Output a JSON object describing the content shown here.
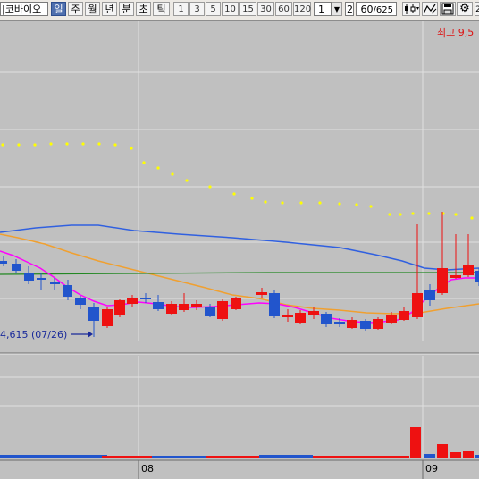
{
  "toolbar": {
    "stock_name": "|코바이오",
    "period_tabs": [
      "일",
      "주",
      "월",
      "년",
      "분",
      "초",
      "틱"
    ],
    "active_tab": "일",
    "intervals": [
      "1",
      "3",
      "5",
      "10",
      "15",
      "30",
      "60",
      "120"
    ],
    "unit_value": "1",
    "count_value": "2",
    "display_count": "60",
    "total_count": "/625",
    "icons": [
      "candle-type-icon",
      "chart-tools-icon",
      "save-icon",
      "settings-icon"
    ]
  },
  "chart": {
    "high_label": "최고 9,5",
    "low_label": "4,615 (07/26)",
    "month_labels": [
      "08",
      "09"
    ]
  },
  "chart_data": {
    "type": "candlestick",
    "overlays": [
      {
        "name": "",
        "color": "#ff00ff",
        "kind": "moving-average"
      },
      {
        "name": "",
        "color": "#f0a030",
        "kind": "moving-average"
      },
      {
        "name": "",
        "color": "#3060e0",
        "kind": "moving-average"
      },
      {
        "name": "",
        "color": "#228822",
        "kind": "moving-average"
      },
      {
        "name": "",
        "color": "#ffff00",
        "kind": "dotted-line"
      }
    ],
    "candle_colors": {
      "up": "#ee1111",
      "down": "#2255cc"
    },
    "volume_colors": {
      "up": "#ee1111",
      "down": "#2255cc"
    }
  }
}
